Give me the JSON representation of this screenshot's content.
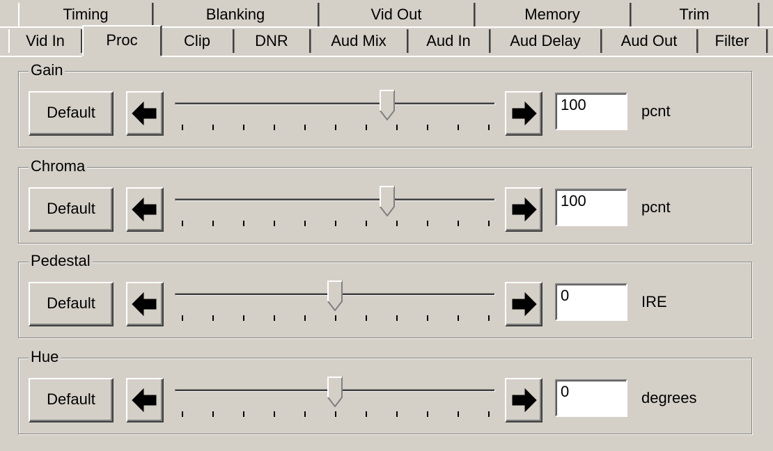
{
  "tabs_back": [
    {
      "label": "Timing"
    },
    {
      "label": "Blanking"
    },
    {
      "label": "Vid Out"
    },
    {
      "label": "Memory"
    },
    {
      "label": "Trim"
    }
  ],
  "tabs_front": [
    {
      "label": "Vid In"
    },
    {
      "label": "Proc",
      "selected": true
    },
    {
      "label": "Clip"
    },
    {
      "label": "DNR"
    },
    {
      "label": "Aud Mix"
    },
    {
      "label": "Aud In"
    },
    {
      "label": "Aud Delay"
    },
    {
      "label": "Aud Out"
    },
    {
      "label": "Filter"
    }
  ],
  "groups": [
    {
      "label": "Gain",
      "button": "Default",
      "value": "100",
      "unit": "pcnt",
      "slider_fraction": 0.67
    },
    {
      "label": "Chroma",
      "button": "Default",
      "value": "100",
      "unit": "pcnt",
      "slider_fraction": 0.67
    },
    {
      "label": "Pedestal",
      "button": "Default",
      "value": "0",
      "unit": "IRE",
      "slider_fraction": 0.5
    },
    {
      "label": "Hue",
      "button": "Default",
      "value": "0",
      "unit": "degrees",
      "slider_fraction": 0.5
    }
  ],
  "icons": {
    "left_arrow": "arrow-left-icon",
    "right_arrow": "arrow-right-icon"
  }
}
